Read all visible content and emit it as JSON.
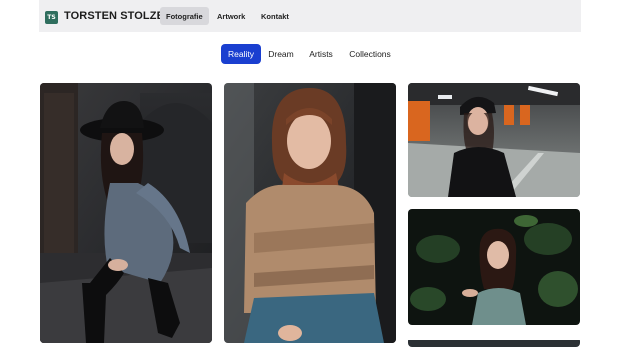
{
  "header": {
    "logo_mark": "TS",
    "brand": "TORSTEN STOLZE",
    "nav": [
      {
        "label": "Fotografie",
        "active": true
      },
      {
        "label": "Artwork",
        "active": false
      },
      {
        "label": "Kontakt",
        "active": false
      }
    ]
  },
  "subnav": {
    "items": [
      {
        "label": "Reality",
        "active": true
      },
      {
        "label": "Dream",
        "active": false
      },
      {
        "label": "Artists",
        "active": false
      },
      {
        "label": "Collections",
        "active": false
      }
    ]
  },
  "colors": {
    "accent": "#1a3fd0",
    "nav_bg": "#efeff1",
    "logo": "#2f6e5e"
  },
  "gallery": [
    {
      "subject": "woman-in-black-hat-sitting"
    },
    {
      "subject": "woman-with-bangs-in-patterned-cardigan"
    },
    {
      "subject": "woman-in-beanie-parking-garage"
    },
    {
      "subject": "woman-among-green-leaves"
    },
    {
      "subject": "photo-partially-visible"
    }
  ]
}
